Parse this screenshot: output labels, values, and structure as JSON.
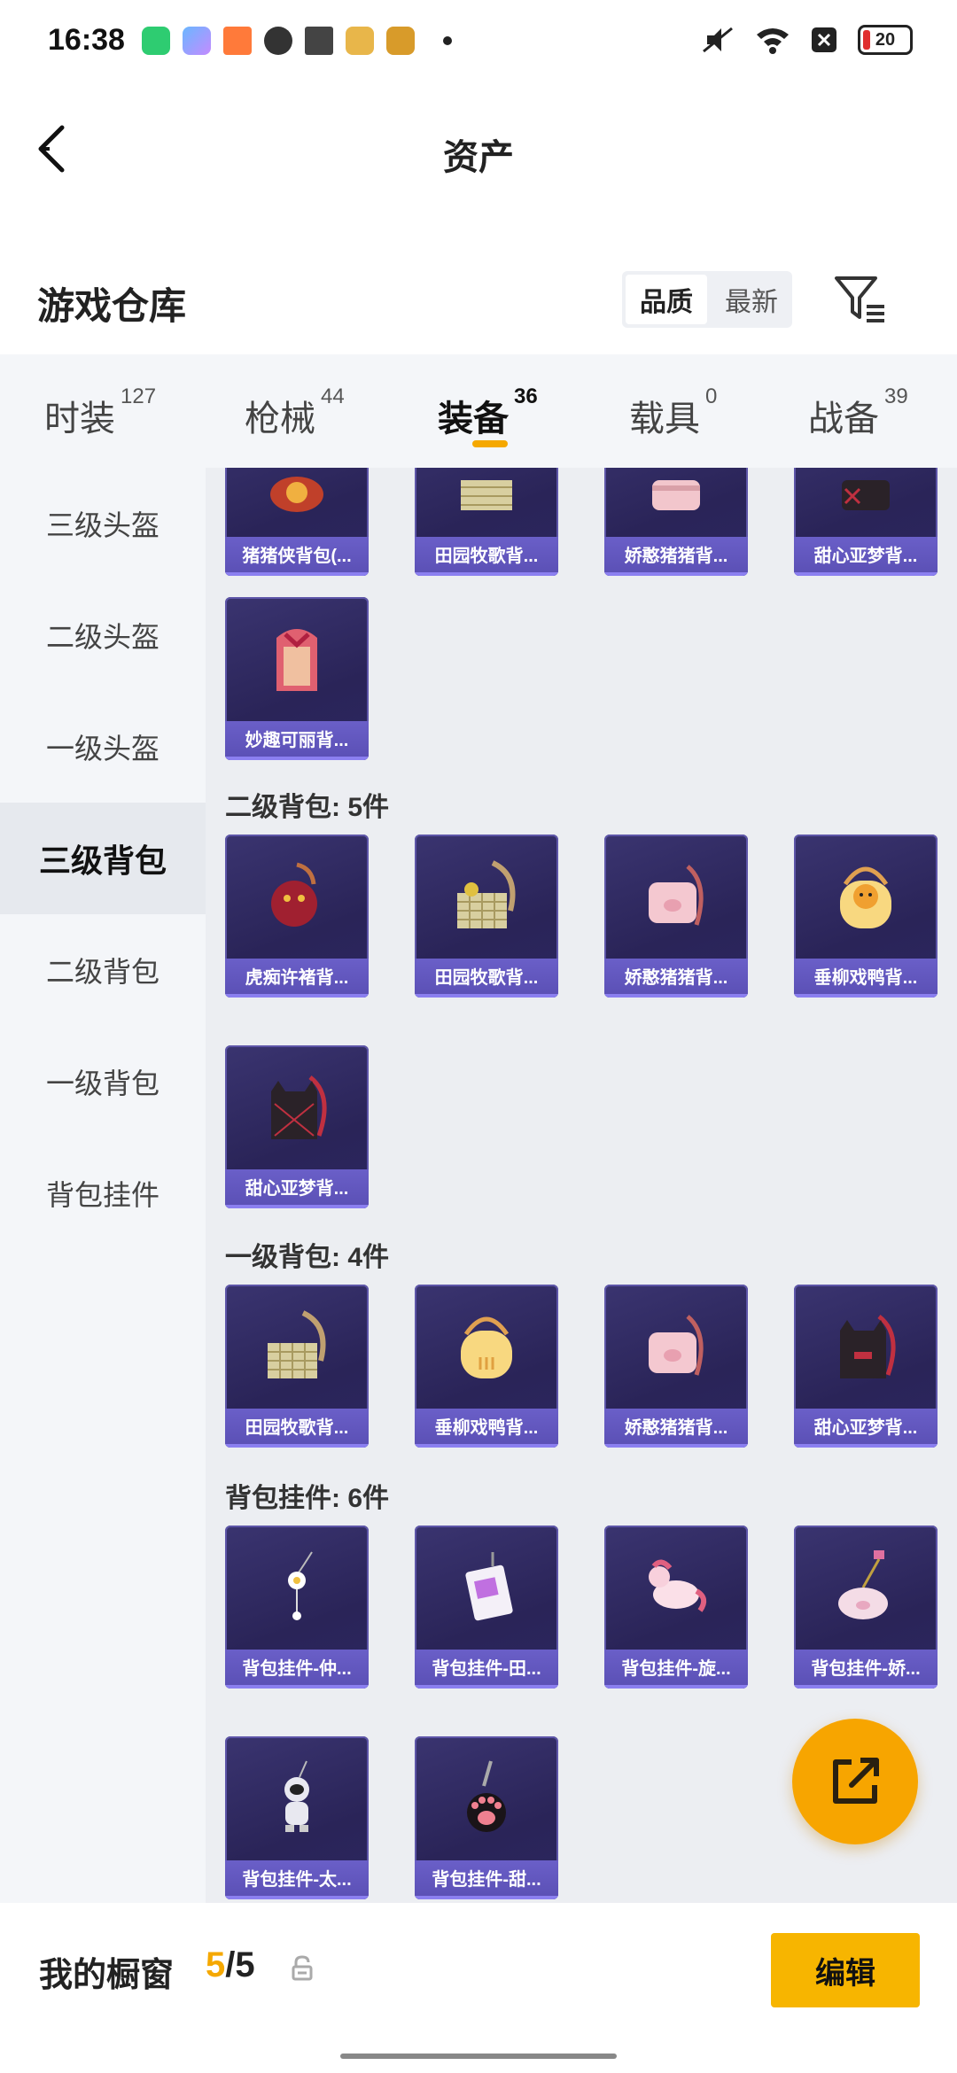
{
  "status": {
    "time": "16:38",
    "battery": "20"
  },
  "header": {
    "title": "资产"
  },
  "warehouse": {
    "title": "游戏仓库",
    "sort_quality": "品质",
    "sort_newest": "最新"
  },
  "tabs": [
    {
      "label": "时装",
      "count": "127"
    },
    {
      "label": "枪械",
      "count": "44"
    },
    {
      "label": "装备",
      "count": "36"
    },
    {
      "label": "载具",
      "count": "0"
    },
    {
      "label": "战备",
      "count": "39"
    }
  ],
  "sidebar": [
    {
      "label": "三级头盔"
    },
    {
      "label": "二级头盔"
    },
    {
      "label": "一级头盔"
    },
    {
      "label": "三级背包"
    },
    {
      "label": "二级背包"
    },
    {
      "label": "一级背包"
    },
    {
      "label": "背包挂件"
    }
  ],
  "groups": {
    "top_row": [
      "猪猪侠背包(...",
      "田园牧歌背...",
      "娇憨猪猪背...",
      "甜心亚梦背..."
    ],
    "top_extra": [
      "妙趣可丽背..."
    ],
    "level2": {
      "title": "二级背包: 5件",
      "items": [
        "虎痴许褚背...",
        "田园牧歌背...",
        "娇憨猪猪背...",
        "垂柳戏鸭背...",
        "甜心亚梦背..."
      ]
    },
    "level1": {
      "title": "一级背包: 4件",
      "items": [
        "田园牧歌背...",
        "垂柳戏鸭背...",
        "娇憨猪猪背...",
        "甜心亚梦背..."
      ]
    },
    "pendants": {
      "title": "背包挂件: 6件",
      "items": [
        "背包挂件-仲...",
        "背包挂件-田...",
        "背包挂件-旋...",
        "背包挂件-娇...",
        "背包挂件-太...",
        "背包挂件-甜..."
      ]
    }
  },
  "bottom": {
    "showcase_label": "我的橱窗",
    "current": "5",
    "total": "/5",
    "edit_label": "编辑"
  },
  "colors": {
    "accent": "#f5a800",
    "card_bg": "#2a2458",
    "card_label": "#5a4fb4"
  }
}
